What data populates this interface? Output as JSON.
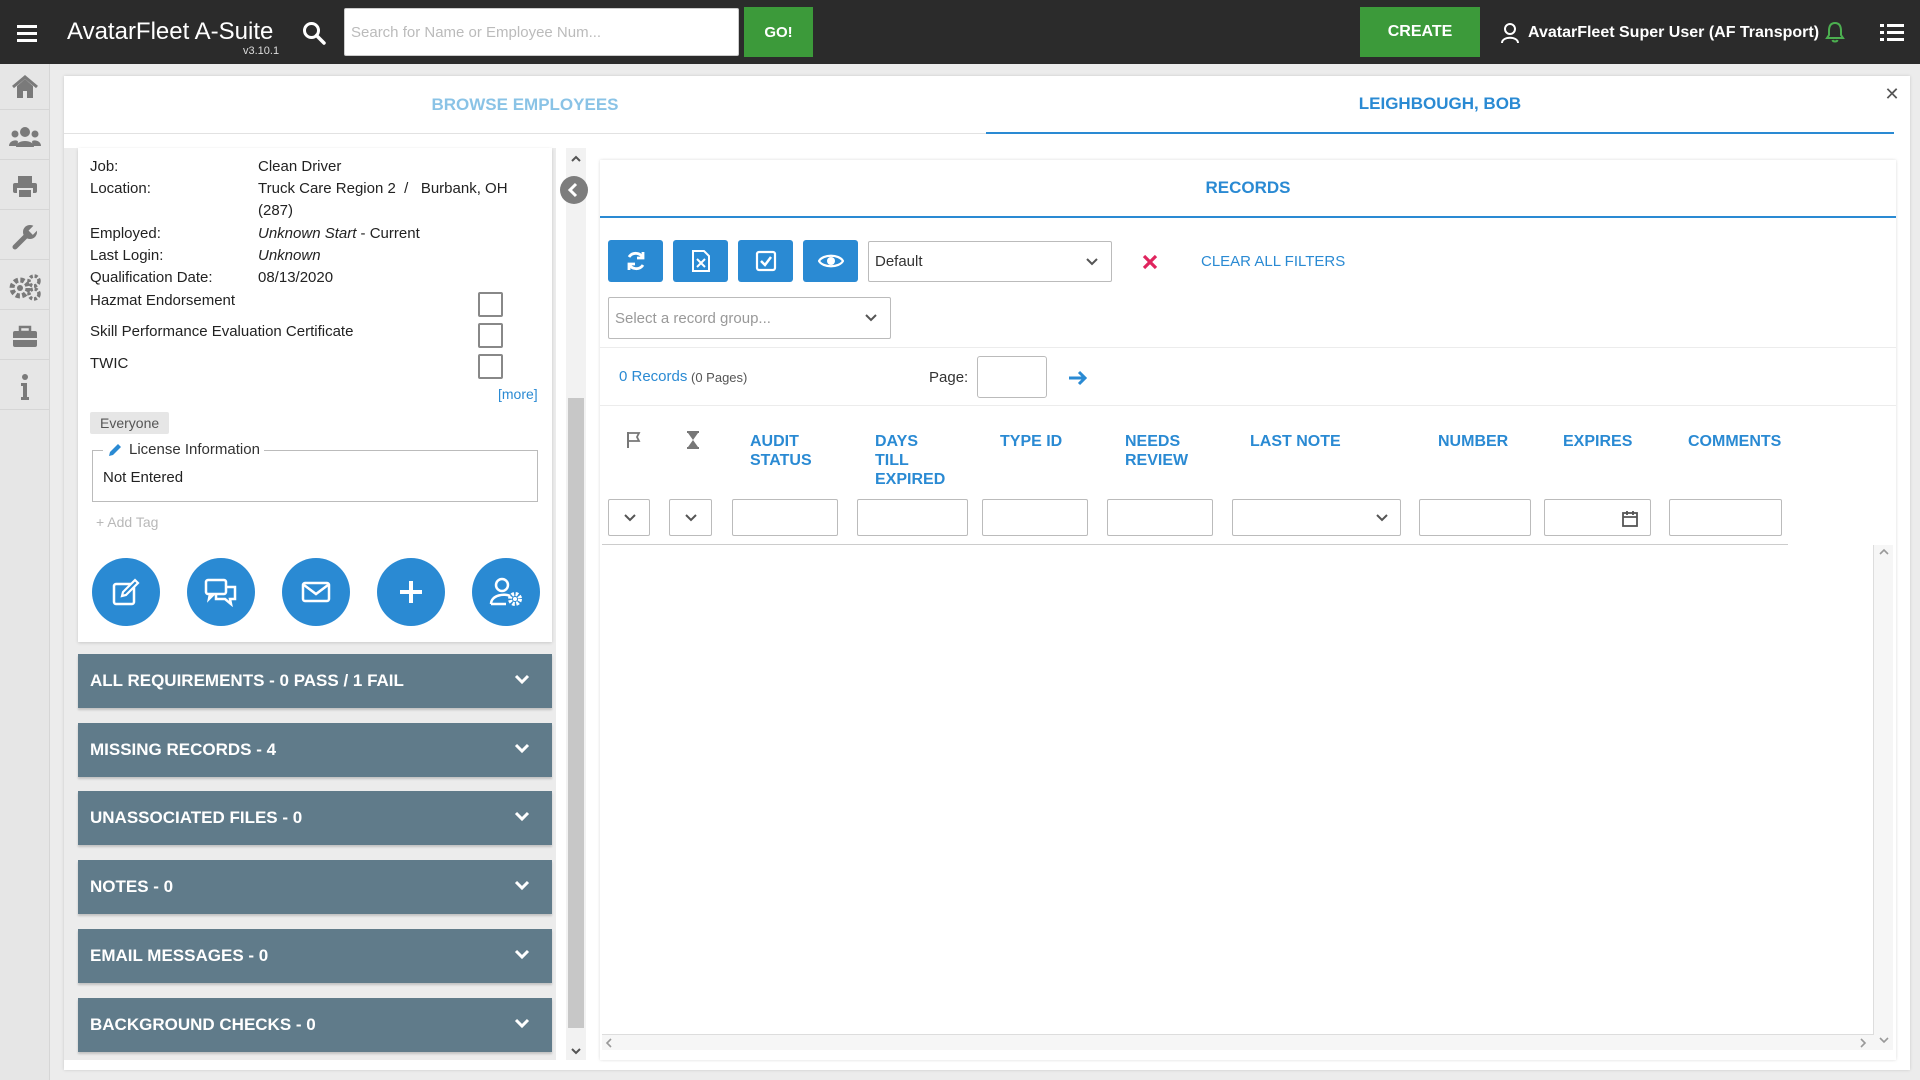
{
  "app": {
    "brand": "AvatarFleet A-Suite",
    "version": "v3.10.1"
  },
  "search": {
    "placeholder": "Search for Name or Employee Num...",
    "go_label": "GO!"
  },
  "topbar": {
    "create_label": "CREATE",
    "user_label": "AvatarFleet Super User (AF Transport)",
    "accent_green": "#3c9a3a"
  },
  "sidebar": {
    "icons": [
      "home-icon",
      "users-icon",
      "print-icon",
      "wrench-icon",
      "gears-icon",
      "briefcase-icon",
      "info-icon"
    ]
  },
  "tabs": {
    "browse": "BROWSE EMPLOYEES",
    "employee": "LEIGHBOUGH, BOB"
  },
  "employee": {
    "fields": [
      {
        "label": "Job:",
        "value": "Clean Driver"
      },
      {
        "label": "Location:",
        "value_line1": "Truck Care Region 2  /   Burbank, OH",
        "value_line2": "(287)"
      },
      {
        "label": "Employed:",
        "value_start": "Unknown Start",
        "value_end": " - Current"
      },
      {
        "label": "Last Login:",
        "value": "Unknown"
      },
      {
        "label": "Qualification Date:",
        "value": "08/13/2020"
      }
    ],
    "certifications": [
      {
        "label": "Hazmat Endorsement",
        "checked": false
      },
      {
        "label": "Skill Performance Evaluation Certificate",
        "checked": false
      },
      {
        "label": "TWIC",
        "checked": false
      }
    ],
    "more_label": "[more]",
    "group_tag": "Everyone",
    "license": {
      "title": "License Information",
      "value": "Not Entered"
    },
    "add_tag": "+ Add Tag",
    "actions": [
      "edit-icon",
      "chat-icon",
      "mail-icon",
      "plus-icon",
      "user-settings-icon"
    ]
  },
  "accordions": [
    "ALL REQUIREMENTS - 0 PASS / 1 FAIL",
    "MISSING RECORDS - 4",
    "UNASSOCIATED FILES - 0",
    "NOTES - 0",
    "EMAIL MESSAGES - 0",
    "BACKGROUND CHECKS - 0"
  ],
  "records": {
    "tab_label": "RECORDS",
    "toolbar_icons": [
      "refresh-icon",
      "excel-icon",
      "checkbox-icon",
      "eye-icon"
    ],
    "view_select": "Default",
    "clear_filters": "CLEAR ALL FILTERS",
    "record_group_placeholder": "Select a record group...",
    "count": "0 Records",
    "pages": "(0 Pages)",
    "page_label": "Page:",
    "page_value": "",
    "columns": [
      {
        "lines": [
          "AUDIT",
          "STATUS"
        ]
      },
      {
        "lines": [
          "DAYS",
          "TILL",
          "EXPIRED"
        ]
      },
      {
        "lines": [
          "TYPE ID"
        ]
      },
      {
        "lines": [
          "NEEDS",
          "REVIEW"
        ]
      },
      {
        "lines": [
          "LAST NOTE"
        ]
      },
      {
        "lines": [
          "NUMBER"
        ]
      },
      {
        "lines": [
          "EXPIRES"
        ]
      },
      {
        "lines": [
          "COMMENTS"
        ]
      }
    ],
    "accent_blue": "#2a8ad3",
    "alert_red": "#e0245e"
  }
}
